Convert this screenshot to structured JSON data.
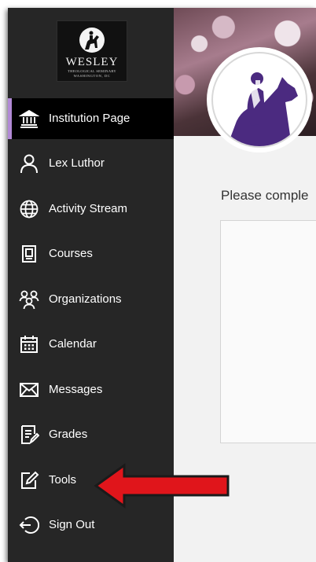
{
  "logo": {
    "title": "WESLEY",
    "subtitle": "THEOLOGICAL SEMINARY",
    "location": "WASHINGTON, DC"
  },
  "sidebar": {
    "items": [
      {
        "label": "Institution Page",
        "icon": "institution-icon",
        "active": true
      },
      {
        "label": "Lex Luthor",
        "icon": "user-icon",
        "active": false
      },
      {
        "label": "Activity Stream",
        "icon": "globe-icon",
        "active": false
      },
      {
        "label": "Courses",
        "icon": "courses-icon",
        "active": false
      },
      {
        "label": "Organizations",
        "icon": "organizations-icon",
        "active": false
      },
      {
        "label": "Calendar",
        "icon": "calendar-icon",
        "active": false
      },
      {
        "label": "Messages",
        "icon": "envelope-icon",
        "active": false
      },
      {
        "label": "Grades",
        "icon": "grades-icon",
        "active": false
      },
      {
        "label": "Tools",
        "icon": "tools-icon",
        "active": false
      },
      {
        "label": "Sign Out",
        "icon": "sign-out-icon",
        "active": false
      }
    ]
  },
  "main": {
    "prompt": "Please comple"
  },
  "colors": {
    "sidebar_bg": "#262626",
    "active_bg": "#000000",
    "active_accent": "#b28ad6",
    "brand_purple": "#4b2a80",
    "annotation_arrow": "#e0151b"
  }
}
